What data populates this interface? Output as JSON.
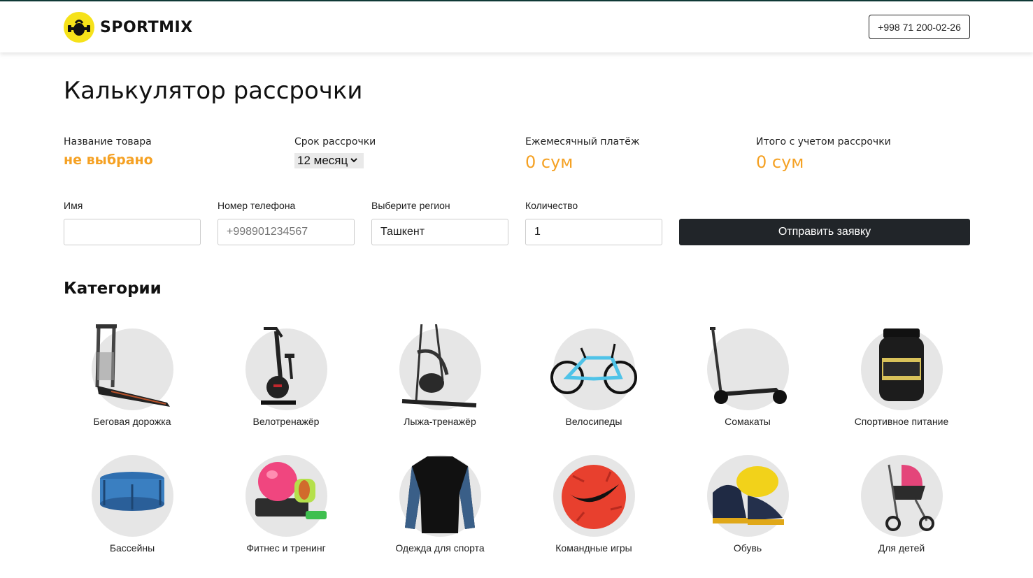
{
  "header": {
    "logo_text": "SPORTMIX",
    "phone": "+998 71 200-02-26"
  },
  "page": {
    "title": "Калькулятор рассрочки"
  },
  "summary": {
    "product_label": "Название товара",
    "product_value": "не выбрано",
    "term_label": "Срок рассрочки",
    "term_value": "12 месяц",
    "monthly_label": "Ежемесячный платёж",
    "monthly_value": "0 сум",
    "total_label": "Итого с учетом рассрочки",
    "total_value": "0 сум"
  },
  "form": {
    "name_label": "Имя",
    "name_value": "",
    "phone_label": "Номер телефона",
    "phone_placeholder": "+998901234567",
    "region_label": "Выберите регион",
    "region_value": "Ташкент",
    "qty_label": "Количество",
    "qty_value": "1",
    "submit_label": "Отправить заявку"
  },
  "categories": {
    "heading": "Категории",
    "items": [
      {
        "label": "Беговая дорожка",
        "icon": "treadmill-icon"
      },
      {
        "label": "Велотренажёр",
        "icon": "exercise-bike-icon"
      },
      {
        "label": "Лыжа-тренажёр",
        "icon": "elliptical-trainer-icon"
      },
      {
        "label": "Велосипеды",
        "icon": "bicycle-icon"
      },
      {
        "label": "Сомакаты",
        "icon": "scooter-icon"
      },
      {
        "label": "Спортивное питание",
        "icon": "protein-jar-icon"
      },
      {
        "label": "Бассейны",
        "icon": "pool-icon"
      },
      {
        "label": "Фитнес и тренинг",
        "icon": "fitness-ball-icon"
      },
      {
        "label": "Одежда для спорта",
        "icon": "sport-shirt-icon"
      },
      {
        "label": "Командные игры",
        "icon": "football-icon"
      },
      {
        "label": "Обувь",
        "icon": "sneakers-icon"
      },
      {
        "label": "Для детей",
        "icon": "stroller-icon"
      }
    ]
  },
  "colors": {
    "accent": "#f5a123",
    "logo_yellow": "#f6e21a",
    "button_dark": "#212529",
    "disc_gray": "#e6e6e6"
  }
}
